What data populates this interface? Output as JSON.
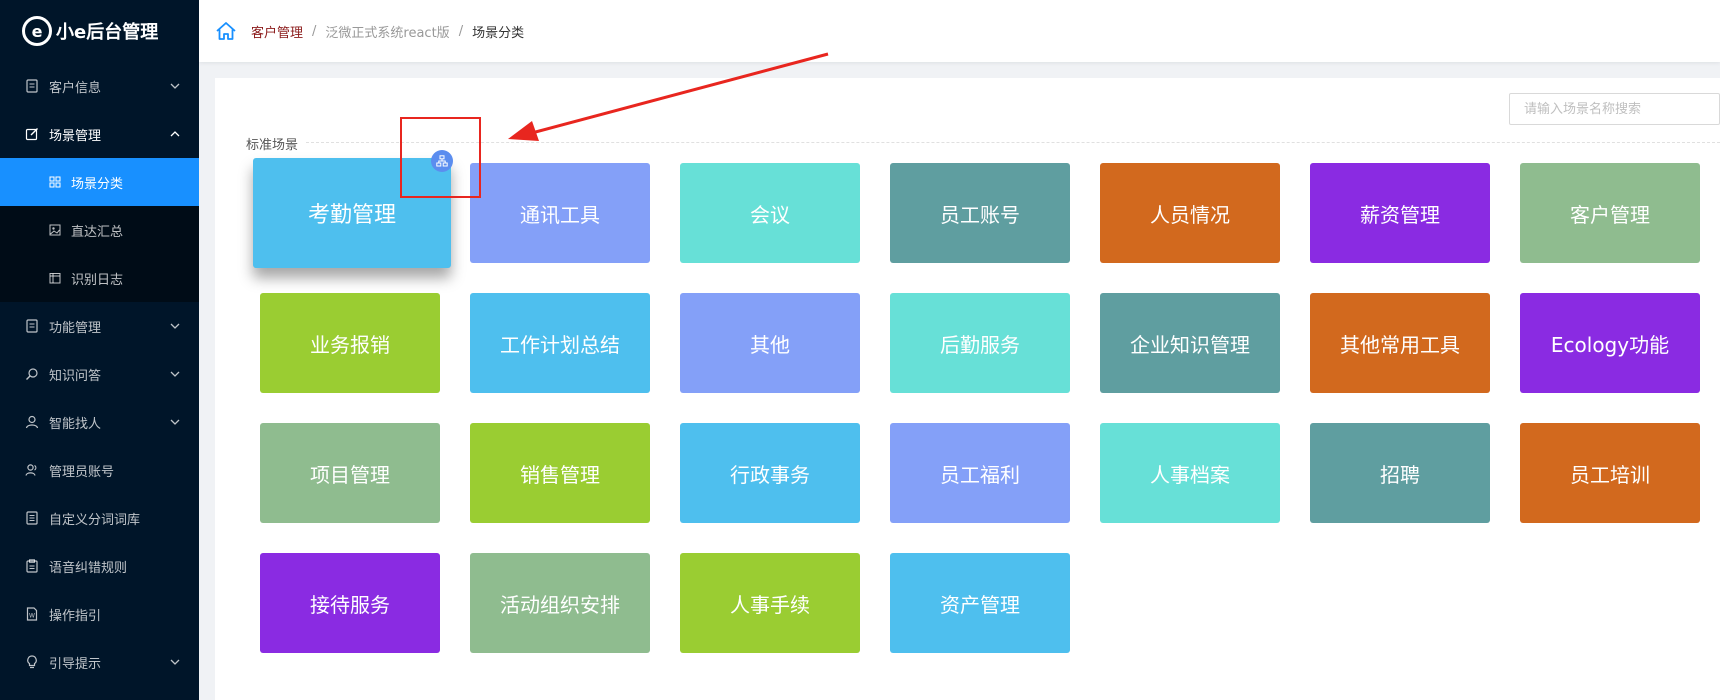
{
  "app": {
    "logo_mark": "e",
    "logo_text": "小e后台管理"
  },
  "sidebar": {
    "items": [
      {
        "label": "客户信息",
        "icon": "document-icon",
        "expandable": true,
        "open": false
      },
      {
        "label": "场景管理",
        "icon": "edit-icon",
        "expandable": true,
        "open": true,
        "children": [
          {
            "label": "场景分类",
            "icon": "grid-icon",
            "active": true
          },
          {
            "label": "直达汇总",
            "icon": "image-icon",
            "active": false
          },
          {
            "label": "识别日志",
            "icon": "calendar-icon",
            "active": false
          }
        ]
      },
      {
        "label": "功能管理",
        "icon": "document-icon",
        "expandable": true,
        "open": false
      },
      {
        "label": "知识问答",
        "icon": "search-icon",
        "expandable": true,
        "open": false
      },
      {
        "label": "智能找人",
        "icon": "user-icon",
        "expandable": true,
        "open": false
      },
      {
        "label": "管理员账号",
        "icon": "user-group-icon",
        "expandable": false,
        "open": false
      },
      {
        "label": "自定义分词词库",
        "icon": "list-icon",
        "expandable": false,
        "open": false
      },
      {
        "label": "语音纠错规则",
        "icon": "clipboard-icon",
        "expandable": false,
        "open": false
      },
      {
        "label": "操作指引",
        "icon": "file-icon",
        "expandable": false,
        "open": false
      },
      {
        "label": "引导提示",
        "icon": "bulb-icon",
        "expandable": true,
        "open": false
      }
    ]
  },
  "breadcrumb": [
    "客户管理",
    "泛微正式系统react版",
    "场景分类"
  ],
  "search": {
    "placeholder": "请输入场景名称搜索"
  },
  "section": {
    "title": "标准场景"
  },
  "tiles": [
    {
      "label": "考勤管理",
      "color": "#4ebfee"
    },
    {
      "label": "通讯工具",
      "color": "#84a0f8"
    },
    {
      "label": "会议",
      "color": "#67e0d7"
    },
    {
      "label": "员工账号",
      "color": "#5f9ea0"
    },
    {
      "label": "人员情况",
      "color": "#d2691e"
    },
    {
      "label": "薪资管理",
      "color": "#8a2be2"
    },
    {
      "label": "客户管理",
      "color": "#8fbc8f"
    },
    {
      "label": "业务报销",
      "color": "#9acd32"
    },
    {
      "label": "工作计划总结",
      "color": "#4ebfee"
    },
    {
      "label": "其他",
      "color": "#84a0f8"
    },
    {
      "label": "后勤服务",
      "color": "#67e0d7"
    },
    {
      "label": "企业知识管理",
      "color": "#5f9ea0"
    },
    {
      "label": "其他常用工具",
      "color": "#d2691e"
    },
    {
      "label": "Ecology功能",
      "color": "#8a2be2"
    },
    {
      "label": "项目管理",
      "color": "#8fbc8f"
    },
    {
      "label": "销售管理",
      "color": "#9acd32"
    },
    {
      "label": "行政事务",
      "color": "#4ebfee"
    },
    {
      "label": "员工福利",
      "color": "#84a0f8"
    },
    {
      "label": "人事档案",
      "color": "#67e0d7"
    },
    {
      "label": "招聘",
      "color": "#5f9ea0"
    },
    {
      "label": "员工培训",
      "color": "#d2691e"
    },
    {
      "label": "接待服务",
      "color": "#8a2be2"
    },
    {
      "label": "活动组织安排",
      "color": "#8fbc8f"
    },
    {
      "label": "人事手续",
      "color": "#9acd32"
    },
    {
      "label": "资产管理",
      "color": "#4ebfee"
    }
  ],
  "colors": {
    "sidebar_bg": "#001529",
    "active": "#1890ff",
    "annotation": "#e8261f"
  }
}
